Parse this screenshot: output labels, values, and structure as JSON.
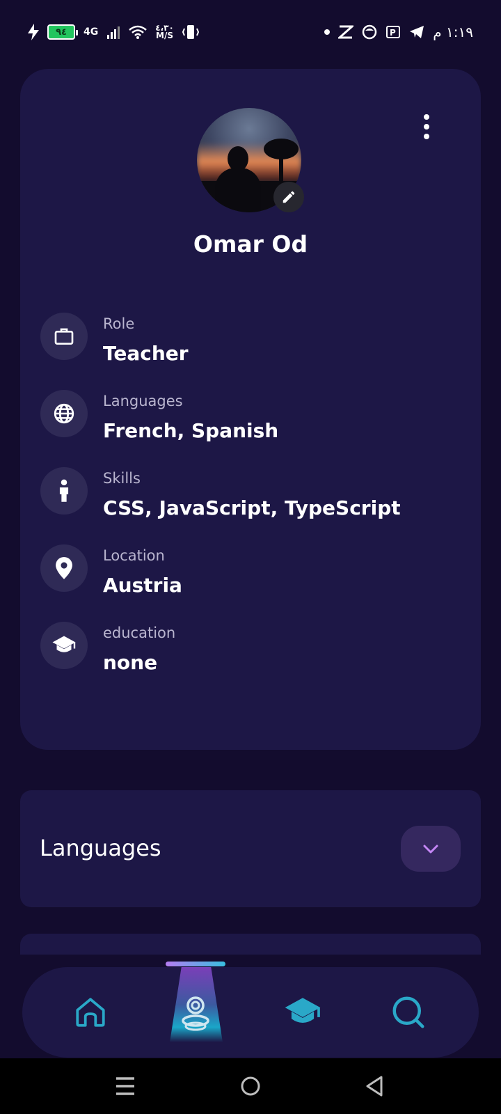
{
  "status_bar": {
    "battery": "٩٤",
    "network": "4G",
    "speed_value": "٤،٣٠",
    "speed_unit": "M/S",
    "time": "١:١٩ م"
  },
  "profile": {
    "name": "Omar Od",
    "info": [
      {
        "icon": "briefcase-icon",
        "label": "Role",
        "value": "Teacher"
      },
      {
        "icon": "globe-icon",
        "label": "Languages",
        "value": "French, Spanish"
      },
      {
        "icon": "person-icon",
        "label": "Skills",
        "value": "CSS, JavaScript, TypeScript"
      },
      {
        "icon": "location-pin-icon",
        "label": "Location",
        "value": "Austria"
      },
      {
        "icon": "graduation-cap-icon",
        "label": "education",
        "value": "none"
      }
    ]
  },
  "languages_section": {
    "title": "Languages",
    "toggle_icon": "chevron-down-icon"
  },
  "bottom_nav": {
    "items": [
      "home-icon",
      "profile-icon",
      "education-icon",
      "search-icon"
    ],
    "active": "profile-icon"
  },
  "colors": {
    "background": "#130c2e",
    "card": "#1d1746",
    "icon_circle": "#2f2a56",
    "accent_teal": "#2aa8c8",
    "accent_purple": "#b57cf2"
  }
}
